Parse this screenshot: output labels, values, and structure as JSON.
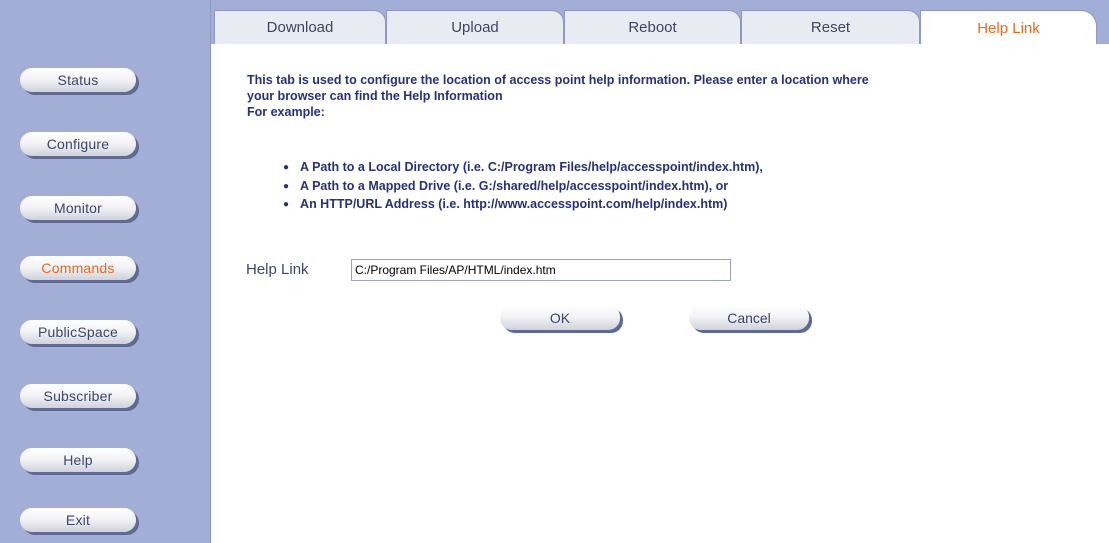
{
  "sidebar": {
    "items": [
      {
        "label": "Status",
        "active": false
      },
      {
        "label": "Configure",
        "active": false
      },
      {
        "label": "Monitor",
        "active": false
      },
      {
        "label": "Commands",
        "active": true
      },
      {
        "label": "PublicSpace",
        "active": false
      },
      {
        "label": "Subscriber",
        "active": false
      },
      {
        "label": "Help",
        "active": false
      },
      {
        "label": "Exit",
        "active": false
      }
    ]
  },
  "tabs": [
    {
      "label": "Download",
      "active": false
    },
    {
      "label": "Upload",
      "active": false
    },
    {
      "label": "Reboot",
      "active": false
    },
    {
      "label": "Reset",
      "active": false
    },
    {
      "label": "Help Link",
      "active": true
    }
  ],
  "content": {
    "intro_line1": "This tab is used to configure the location of access point help information. Please enter a location where",
    "intro_line2": "your browser can find the Help Information",
    "intro_line3": "For example:",
    "bullets": [
      "A Path to a Local Directory (i.e. C:/Program Files/help/accesspoint/index.htm),",
      "A Path to a Mapped Drive (i.e. G:/shared/help/accesspoint/index.htm), or",
      "An HTTP/URL Address (i.e. http://www.accesspoint.com/help/index.htm)"
    ],
    "field_label": "Help Link",
    "field_value": "C:/Program Files/AP/HTML/index.htm",
    "ok_label": "OK",
    "cancel_label": "Cancel"
  },
  "colors": {
    "sidebar_bg": "#a2aed6",
    "accent_active": "#ea6a1c",
    "text_bold": "#27307d",
    "text_normal": "#3b466b"
  }
}
